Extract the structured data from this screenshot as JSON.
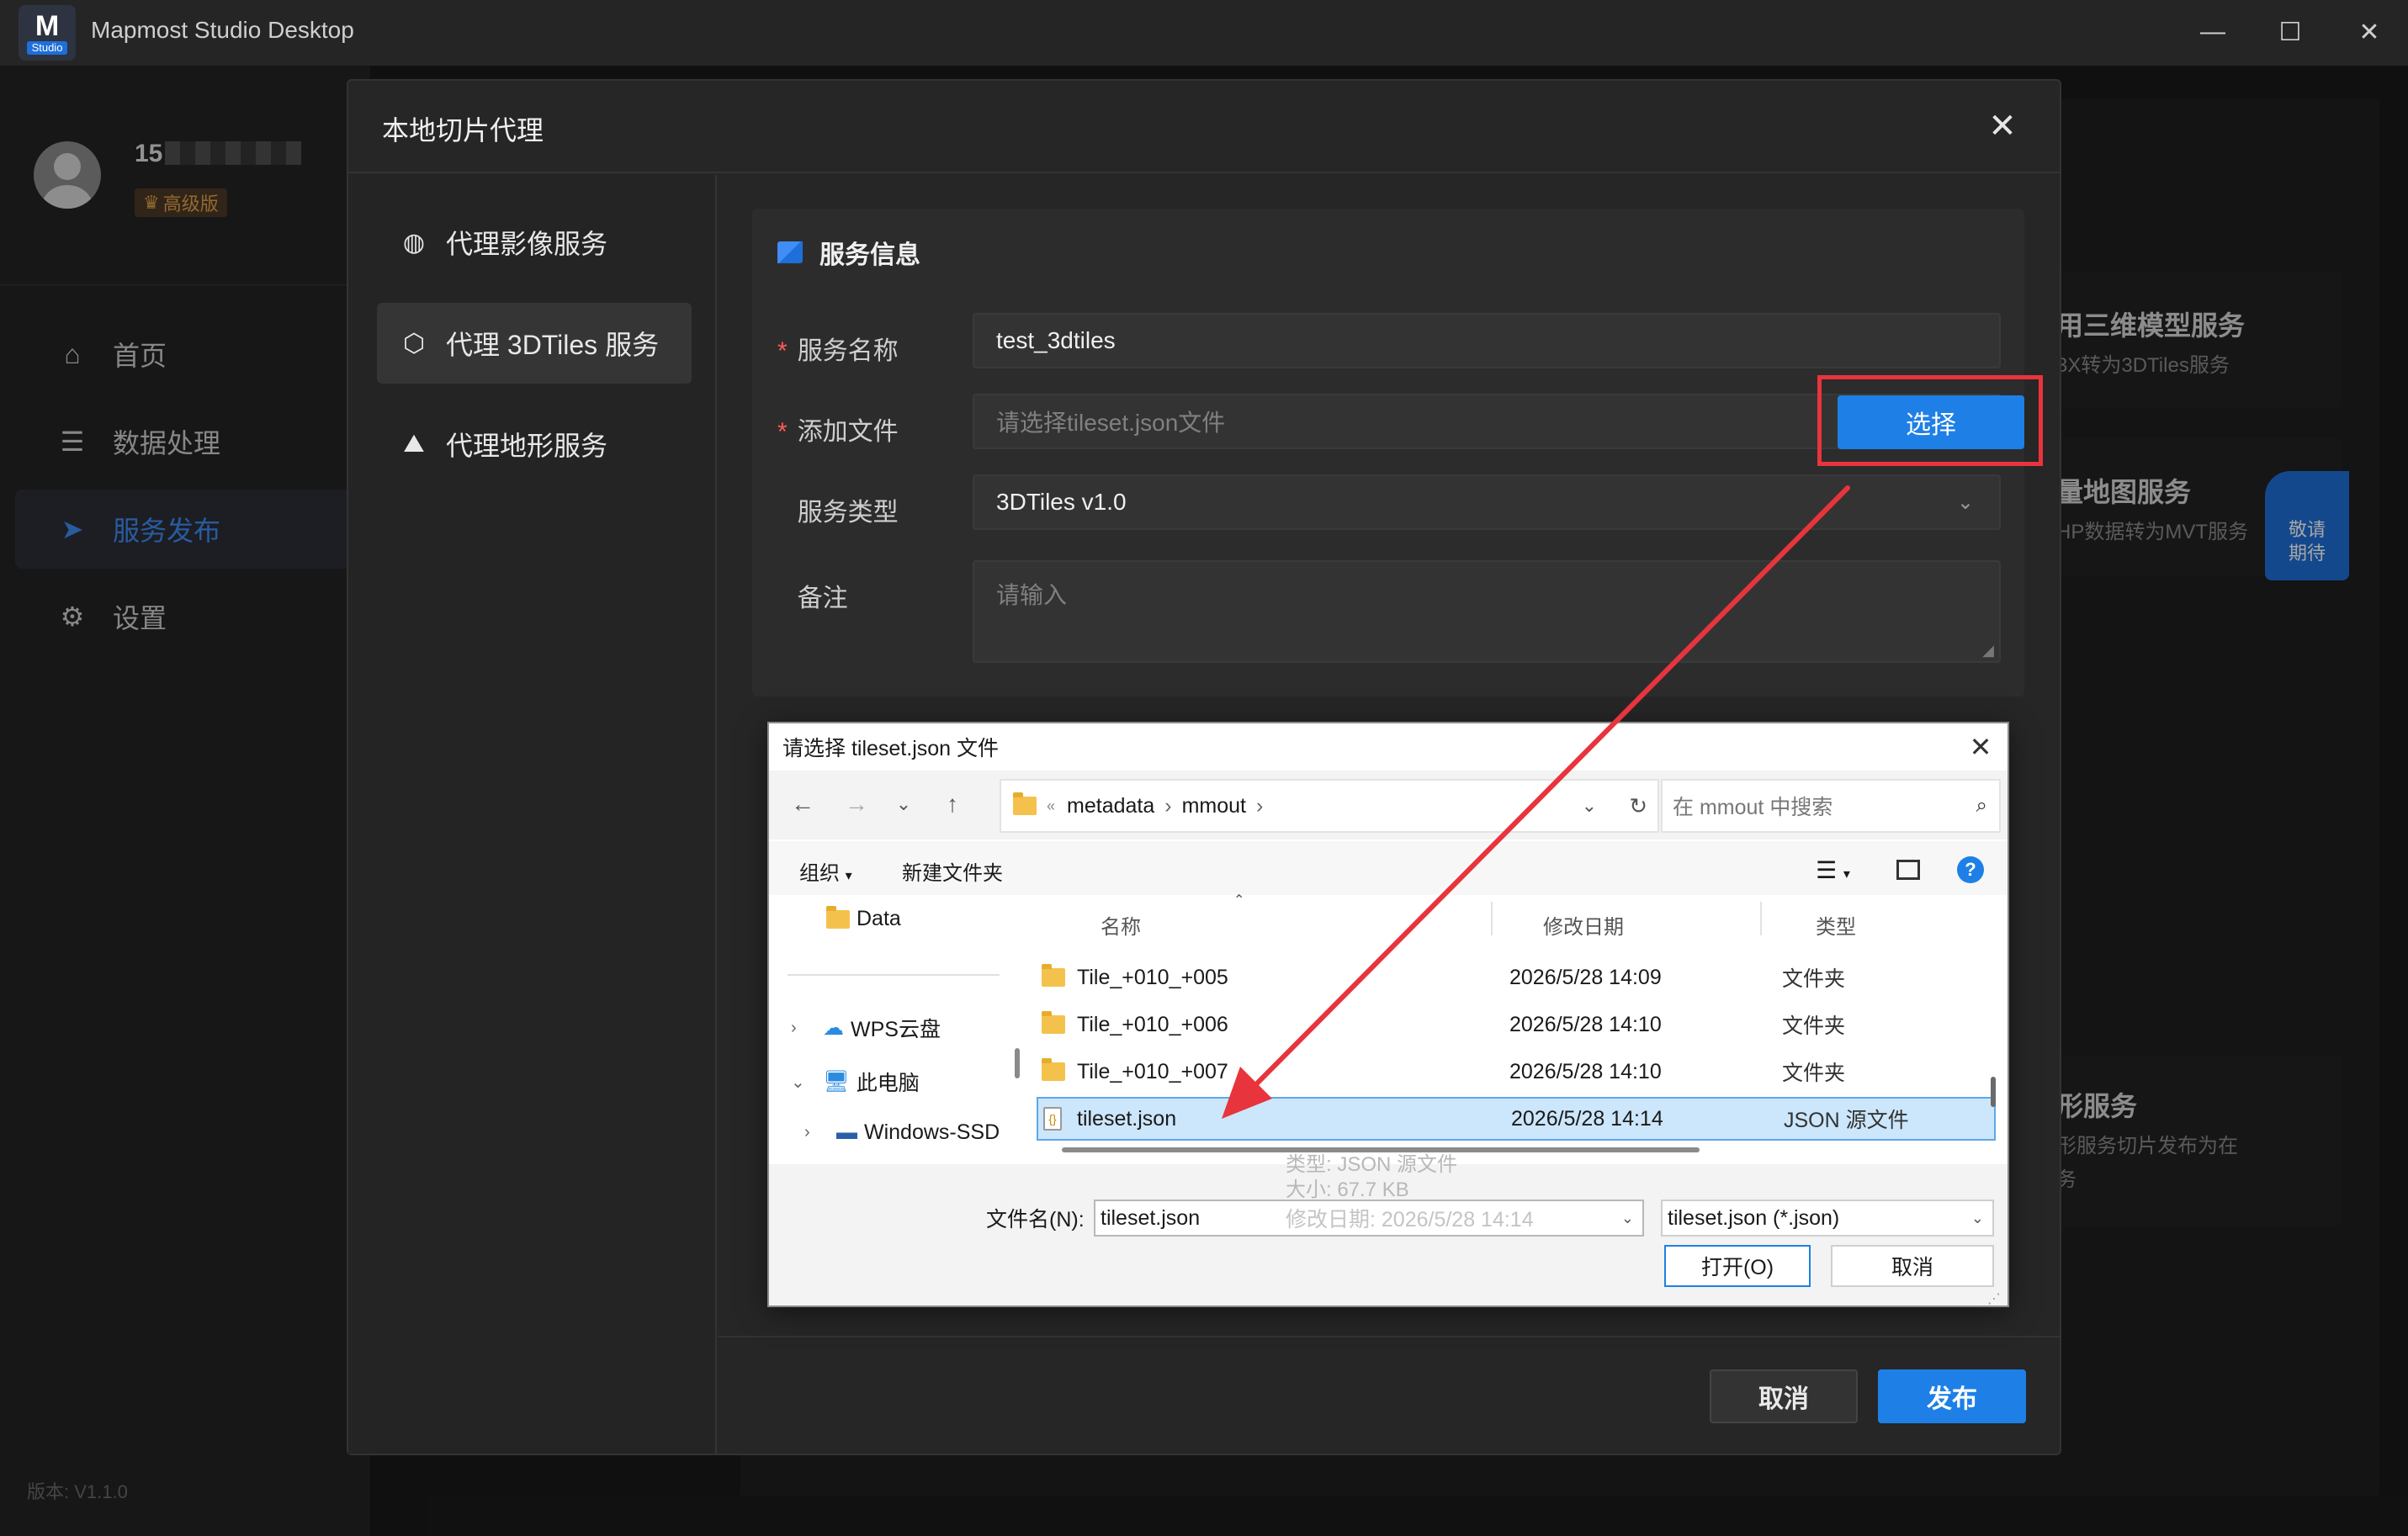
{
  "app": {
    "logo_text": "M",
    "logo_sub": "Studio",
    "title": "Mapmost Studio Desktop"
  },
  "user": {
    "name": "15",
    "tier": "高级版"
  },
  "sidebar": {
    "items": [
      {
        "label": "首页",
        "icon": "home-icon"
      },
      {
        "label": "数据处理",
        "icon": "database-icon"
      },
      {
        "label": "服务发布",
        "icon": "send-icon",
        "active": true
      },
      {
        "label": "设置",
        "icon": "gear-icon"
      }
    ],
    "version": "版本: V1.1.0"
  },
  "background_cards": [
    {
      "title": "用三维模型服务",
      "desc": "3X转为3DTiles服务"
    },
    {
      "title": "量地图服务",
      "desc": "HP数据转为MVT服务",
      "ribbon": "敬请\n期待"
    },
    {
      "title": "形服务",
      "desc": "形服务切片发布为在",
      "desc2": "务"
    }
  ],
  "modal": {
    "title": "本地切片代理",
    "menu": [
      {
        "label": "代理影像服务",
        "icon": "globe-icon"
      },
      {
        "label": "代理 3DTiles 服务",
        "icon": "cube-icon",
        "active": true
      },
      {
        "label": "代理地形服务",
        "icon": "terrain-icon"
      }
    ],
    "section_title": "服务信息",
    "fields": {
      "name_label": "服务名称",
      "name_value": "test_3dtiles",
      "file_label": "添加文件",
      "file_placeholder": "请选择tileset.json文件",
      "choose_label": "选择",
      "type_label": "服务类型",
      "type_value": "3DTiles v1.0",
      "note_label": "备注",
      "note_placeholder": "请输入"
    },
    "cancel_label": "取消",
    "publish_label": "发布"
  },
  "file_dialog": {
    "title": "请选择 tileset.json 文件",
    "breadcrumb": [
      "metadata",
      "mmout"
    ],
    "search_placeholder": "在 mmout 中搜索",
    "organize_label": "组织",
    "new_folder_label": "新建文件夹",
    "tree": [
      {
        "label": "Data"
      },
      {
        "label": "WPS云盘"
      },
      {
        "label": "此电脑"
      },
      {
        "label": "Windows-SSD"
      }
    ],
    "columns": {
      "name": "名称",
      "date": "修改日期",
      "type": "类型"
    },
    "files": [
      {
        "name": "Tile_+010_+005",
        "date": "2026/5/28 14:09",
        "type": "文件夹"
      },
      {
        "name": "Tile_+010_+006",
        "date": "2026/5/28 14:10",
        "type": "文件夹"
      },
      {
        "name": "Tile_+010_+007",
        "date": "2026/5/28 14:10",
        "type": "文件夹"
      },
      {
        "name": "tileset.json",
        "date": "2026/5/28 14:14",
        "type": "JSON 源文件",
        "selected": true
      }
    ],
    "tooltip": {
      "type": "类型: JSON 源文件",
      "size": "大小: 67.7 KB",
      "modified": "修改日期: 2026/5/28 14:14"
    },
    "filename_label": "文件名(N):",
    "filename_value": "tileset.json",
    "filetype_value": "tileset.json (*.json)",
    "open_label": "打开(O)",
    "cancel_label": "取消"
  },
  "annotation": {
    "color": "#e8343c"
  }
}
